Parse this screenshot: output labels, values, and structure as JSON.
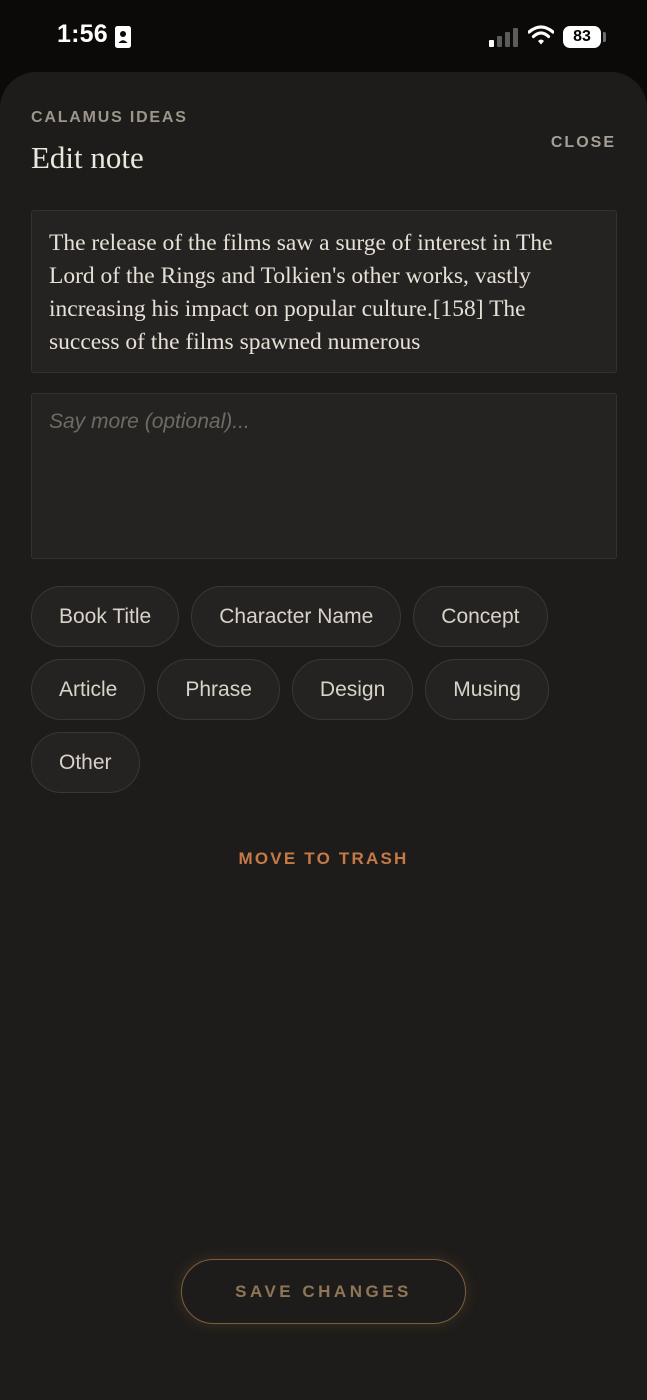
{
  "status_bar": {
    "time": "1:56",
    "battery": "83",
    "icons": [
      "id-card-icon",
      "cellular-signal-icon",
      "wifi-icon",
      "battery-icon"
    ]
  },
  "header": {
    "eyebrow": "CALAMUS IDEAS",
    "title": "Edit note",
    "close_label": "CLOSE"
  },
  "note": {
    "text": "The release of the films saw a surge of interest in The Lord of the Rings and Tolkien's other works, vastly increasing his impact on popular culture.[158] The success of the films spawned numerous"
  },
  "more": {
    "placeholder": "Say more (optional)..."
  },
  "categories": {
    "rows": [
      [
        "Book Title",
        "Character Name",
        "Concept"
      ],
      [
        "Article",
        "Phrase",
        "Design",
        "Musing"
      ],
      [
        "Other"
      ]
    ]
  },
  "actions": {
    "trash_label": "MOVE TO TRASH",
    "save_label": "SAVE CHANGES"
  },
  "colors": {
    "sheet_background": "#1e1c1a",
    "trash_accent": "#c47a45",
    "save_accent": "#8e7657"
  }
}
